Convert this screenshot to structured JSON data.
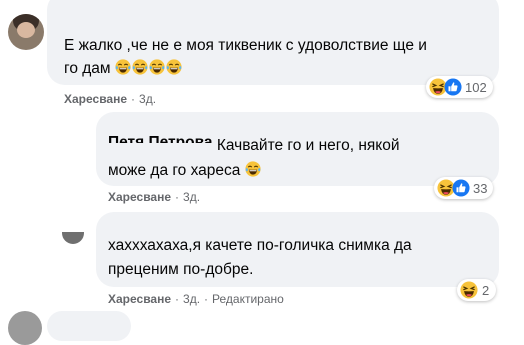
{
  "comments": [
    {
      "text_line1": "Е жалко ,че не е моя тиквеник с удоволствие ще и",
      "text_line2": "го дам",
      "emoji_count": 4,
      "like_label": "Харесване",
      "time": "3д.",
      "reaction_count": "102",
      "reactions": [
        "haha-icon",
        "like-icon"
      ]
    },
    {
      "author": "Петя Петрова",
      "text_line1": "Качвайте го и него, някой",
      "text_line2": "може да го хареса",
      "emoji_count": 1,
      "like_label": "Харесване",
      "time": "3д.",
      "reaction_count": "33",
      "reactions": [
        "haha-icon",
        "like-icon"
      ]
    },
    {
      "text_line1": "хахххахаха,я качете по-голичка снимка да",
      "text_line2": "преценим по-добре.",
      "like_label": "Харесване",
      "time": "3д.",
      "edited_label": "Редактирано",
      "reaction_count": "2",
      "reactions": [
        "haha-icon"
      ]
    }
  ],
  "colors": {
    "bubble": "#f0f2f5",
    "meta": "#65676b",
    "like_blue": "#1877f2",
    "haha_yellow": "#f7c33b"
  }
}
